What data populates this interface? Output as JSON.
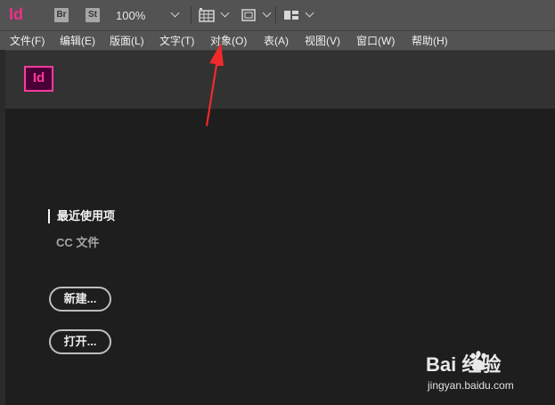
{
  "toolbar": {
    "app_logo": "Id",
    "bridge_badge": "Br",
    "stock_badge": "St",
    "zoom": "100%",
    "icons": [
      "frame-grid-icon",
      "screen-mode-icon",
      "arrange-documents-icon"
    ]
  },
  "menu": {
    "items": [
      {
        "label": "文件(F)"
      },
      {
        "label": "编辑(E)"
      },
      {
        "label": "版面(L)"
      },
      {
        "label": "文字(T)"
      },
      {
        "label": "对象(O)"
      },
      {
        "label": "表(A)"
      },
      {
        "label": "视图(V)"
      },
      {
        "label": "窗口(W)"
      },
      {
        "label": "帮助(H)"
      }
    ]
  },
  "start": {
    "logo": "Id",
    "nav": {
      "recent": "最近使用项",
      "cc_files": "CC 文件"
    },
    "buttons": {
      "new": "新建...",
      "open": "打开..."
    }
  },
  "annotation": {
    "arrow_color": "#f02a2a",
    "points_to": "对象(O)"
  },
  "watermark": {
    "brand": "Bai  经验",
    "url": "jingyan.baidu.com"
  },
  "colors": {
    "accent": "#ff3a9a",
    "chrome": "#535353",
    "background": "#1e1e1e"
  }
}
